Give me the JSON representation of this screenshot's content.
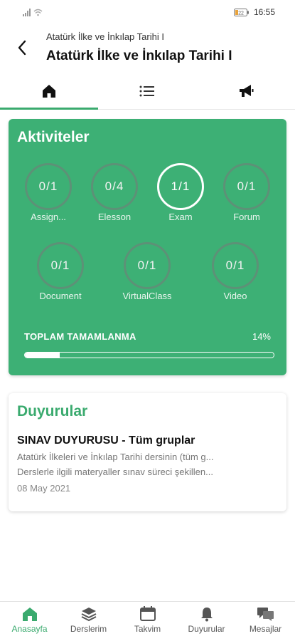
{
  "status_bar": {
    "time": "16:55",
    "battery": "22"
  },
  "header": {
    "subtitle": "Atatürk İlke ve İnkılap Tarihi I",
    "title": "Atatürk İlke ve İnkılap Tarihi I"
  },
  "tabs": [
    {
      "icon": "home-icon",
      "active": true
    },
    {
      "icon": "list-icon",
      "active": false
    },
    {
      "icon": "megaphone-icon",
      "active": false
    }
  ],
  "activities": {
    "title": "Aktiviteler",
    "items": [
      {
        "value": "0/1",
        "label": "Assign...",
        "done": false
      },
      {
        "value": "0/4",
        "label": "Elesson",
        "done": false
      },
      {
        "value": "1/1",
        "label": "Exam",
        "done": true
      },
      {
        "value": "0/1",
        "label": "Forum",
        "done": false
      },
      {
        "value": "0/1",
        "label": "Document",
        "done": false
      },
      {
        "value": "0/1",
        "label": "VirtualClass",
        "done": false
      },
      {
        "value": "0/1",
        "label": "Video",
        "done": false
      }
    ],
    "total_label": "TOPLAM TAMAMLANMA",
    "total_percent": "14%",
    "progress_fraction": 0.14
  },
  "announcements": {
    "title": "Duyurular",
    "item_title": "SINAV DUYURUSU - Tüm gruplar",
    "line1": "Atatürk İlkeleri ve İnkılap Tarihi dersinin (tüm g...",
    "line2": "Derslerle ilgili materyaller sınav süreci şekillen...",
    "date": "08 May 2021"
  },
  "bottom_nav": [
    {
      "label": "Anasayfa",
      "icon": "home-icon",
      "active": true
    },
    {
      "label": "Derslerim",
      "icon": "layers-icon",
      "active": false
    },
    {
      "label": "Takvim",
      "icon": "calendar-icon",
      "active": false
    },
    {
      "label": "Duyurular",
      "icon": "bell-icon",
      "active": false
    },
    {
      "label": "Mesajlar",
      "icon": "chat-icon",
      "active": false
    }
  ],
  "colors": {
    "accent": "#3db075",
    "accent_text": "#3aaa6e"
  }
}
